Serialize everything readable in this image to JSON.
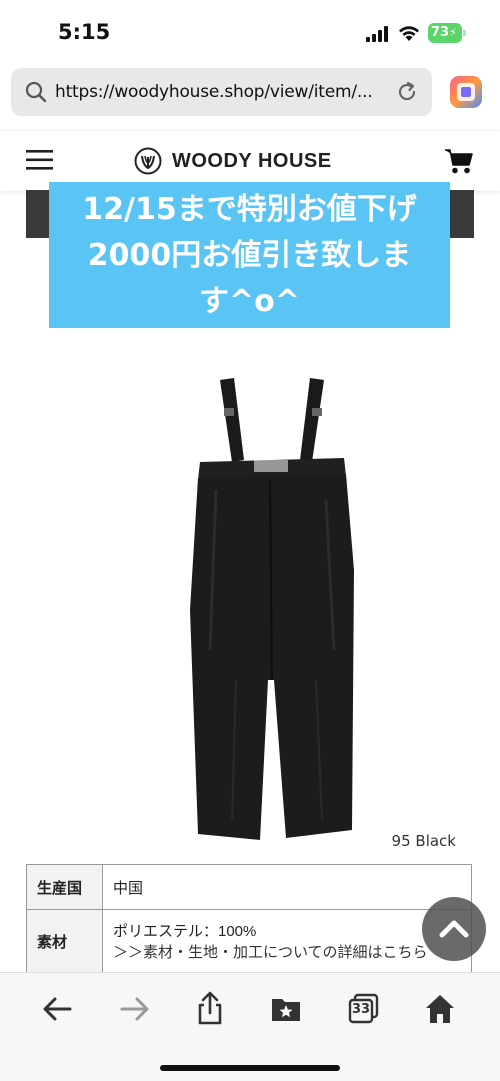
{
  "status": {
    "time": "5:15",
    "battery": "73"
  },
  "browser": {
    "url": "https://woodyhouse.shop/view/item/..."
  },
  "site": {
    "brand": "WOODY HOUSE"
  },
  "banner": {
    "line1": "12/15まで特別お値下げ",
    "line2": "2000円お値引き致しま",
    "line3": "す^o^"
  },
  "product": {
    "color_caption": "95 Black"
  },
  "specs": [
    {
      "label": "生産国",
      "value": "中国"
    },
    {
      "label": "素材",
      "value": "ポリエステル：100%",
      "link": "＞＞素材・生地・加工についての詳細はこちら"
    }
  ],
  "toolbar": {
    "tabs_count": "33"
  },
  "colors": {
    "banner_bg": "#5ac4f4",
    "battery": "#5bd46a"
  }
}
